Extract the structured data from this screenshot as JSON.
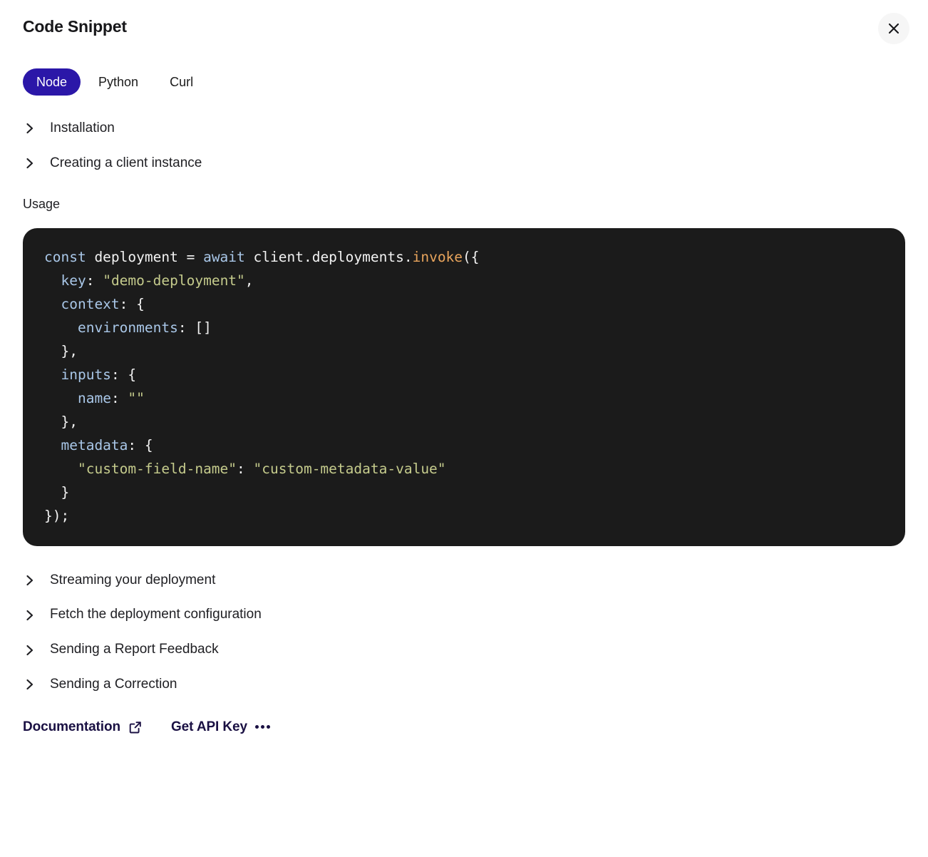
{
  "header": {
    "title": "Code Snippet",
    "close_icon": "close-icon"
  },
  "tabs": {
    "active": "Node",
    "items": [
      {
        "label": "Node",
        "active": true
      },
      {
        "label": "Python",
        "active": false
      },
      {
        "label": "Curl",
        "active": false
      }
    ]
  },
  "top_sections": [
    {
      "label": "Installation",
      "icon": "chevron-right-icon",
      "expanded": false
    },
    {
      "label": "Creating a client instance",
      "icon": "chevron-right-icon",
      "expanded": false
    }
  ],
  "usage": {
    "label": "Usage",
    "code_lines": [
      [
        {
          "t": "const",
          "c": "kw"
        },
        {
          "t": " deployment ",
          "c": "plain"
        },
        {
          "t": "= ",
          "c": "plain"
        },
        {
          "t": "await",
          "c": "kw"
        },
        {
          "t": " client.deployments.",
          "c": "plain"
        },
        {
          "t": "invoke",
          "c": "fn"
        },
        {
          "t": "({",
          "c": "plain"
        }
      ],
      [
        {
          "t": "  ",
          "c": "plain"
        },
        {
          "t": "key",
          "c": "prop"
        },
        {
          "t": ": ",
          "c": "plain"
        },
        {
          "t": "\"demo-deployment\"",
          "c": "str"
        },
        {
          "t": ",",
          "c": "plain"
        }
      ],
      [
        {
          "t": "  ",
          "c": "plain"
        },
        {
          "t": "context",
          "c": "prop"
        },
        {
          "t": ": {",
          "c": "plain"
        }
      ],
      [
        {
          "t": "    ",
          "c": "plain"
        },
        {
          "t": "environments",
          "c": "prop"
        },
        {
          "t": ": []",
          "c": "plain"
        }
      ],
      [
        {
          "t": "  },",
          "c": "plain"
        }
      ],
      [
        {
          "t": "  ",
          "c": "plain"
        },
        {
          "t": "inputs",
          "c": "prop"
        },
        {
          "t": ": {",
          "c": "plain"
        }
      ],
      [
        {
          "t": "    ",
          "c": "plain"
        },
        {
          "t": "name",
          "c": "prop"
        },
        {
          "t": ": ",
          "c": "plain"
        },
        {
          "t": "\"\"",
          "c": "str"
        }
      ],
      [
        {
          "t": "  },",
          "c": "plain"
        }
      ],
      [
        {
          "t": "  ",
          "c": "plain"
        },
        {
          "t": "metadata",
          "c": "prop"
        },
        {
          "t": ": {",
          "c": "plain"
        }
      ],
      [
        {
          "t": "    ",
          "c": "plain"
        },
        {
          "t": "\"custom-field-name\"",
          "c": "str"
        },
        {
          "t": ": ",
          "c": "plain"
        },
        {
          "t": "\"custom-metadata-value\"",
          "c": "str"
        }
      ],
      [
        {
          "t": "  }",
          "c": "plain"
        }
      ],
      [
        {
          "t": "});",
          "c": "plain"
        }
      ]
    ],
    "code_text": "const deployment = await client.deployments.invoke({\n  key: \"demo-deployment\",\n  context: {\n    environments: []\n  },\n  inputs: {\n    name: \"\"\n  },\n  metadata: {\n    \"custom-field-name\": \"custom-metadata-value\"\n  }\n});"
  },
  "bottom_sections": [
    {
      "label": "Streaming your deployment",
      "icon": "chevron-right-icon",
      "expanded": false
    },
    {
      "label": "Fetch the deployment configuration",
      "icon": "chevron-right-icon",
      "expanded": false
    },
    {
      "label": "Sending a Report Feedback",
      "icon": "chevron-right-icon",
      "expanded": false
    },
    {
      "label": "Sending a Correction",
      "icon": "chevron-right-icon",
      "expanded": false
    }
  ],
  "footer": {
    "documentation": {
      "label": "Documentation",
      "icon": "external-link-icon"
    },
    "api_key": {
      "label": "Get API Key",
      "icon": "ellipsis-icon"
    }
  },
  "colors": {
    "accent": "#2b17a8",
    "footer_text": "#1a1043",
    "code_background": "#1b1b1b",
    "code_keyword": "#a9c7e8",
    "code_string": "#c5cb8c",
    "code_function": "#e8a45c",
    "code_plain": "#f2f2f2",
    "page_background": "#ffffff"
  }
}
